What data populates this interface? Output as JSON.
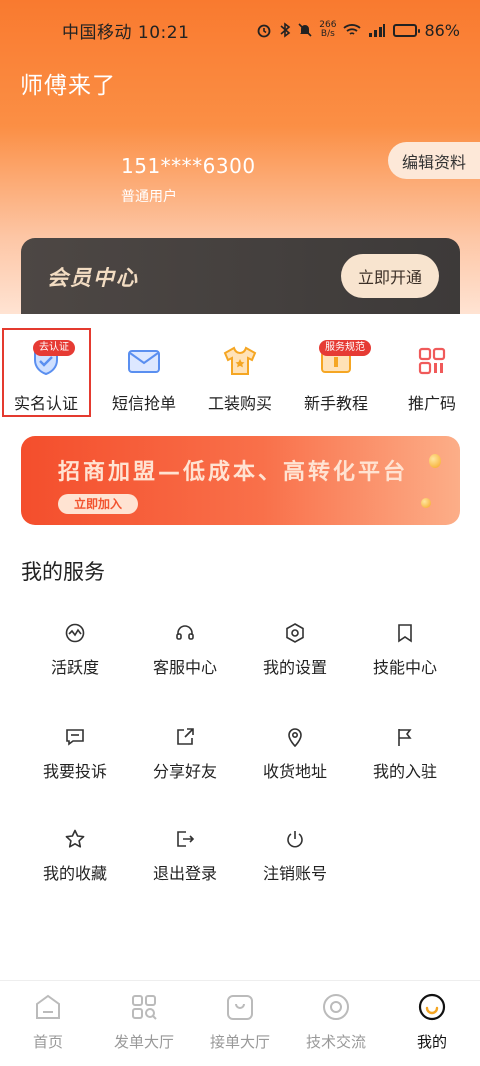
{
  "status_bar": {
    "carrier_time": "中国移动 10:21",
    "net_speed_value": "266",
    "net_speed_unit": "B/s",
    "battery_percent": "86%",
    "battery_level": 0.86
  },
  "header": {
    "app_title": "师傅来了",
    "phone": "151****6300",
    "user_type": "普通用户",
    "edit_label": "编辑资料"
  },
  "vip": {
    "title": "会员中心",
    "button_label": "立即开通"
  },
  "quick_actions": [
    {
      "label": "实名认证",
      "badge": "去认证",
      "icon": "shield-check-icon"
    },
    {
      "label": "短信抢单",
      "icon": "envelope-icon"
    },
    {
      "label": "工装购买",
      "icon": "shirt-icon"
    },
    {
      "label": "新手教程",
      "badge": "服务规范",
      "icon": "monitor-icon"
    },
    {
      "label": "推广码",
      "icon": "qr-code-icon"
    }
  ],
  "banner": {
    "title": "招商加盟—低成本、高转化平台",
    "button_label": "立即加入"
  },
  "services": {
    "title": "我的服务",
    "items": [
      {
        "label": "活跃度",
        "icon": "activity-icon"
      },
      {
        "label": "客服中心",
        "icon": "headset-icon"
      },
      {
        "label": "我的设置",
        "icon": "settings-hex-icon"
      },
      {
        "label": "技能中心",
        "icon": "bookmark-icon"
      },
      {
        "label": "我要投诉",
        "icon": "message-icon"
      },
      {
        "label": "分享好友",
        "icon": "share-icon"
      },
      {
        "label": "收货地址",
        "icon": "location-pin-icon"
      },
      {
        "label": "我的入驻",
        "icon": "flag-icon"
      },
      {
        "label": "我的收藏",
        "icon": "star-icon"
      },
      {
        "label": "退出登录",
        "icon": "logout-icon"
      },
      {
        "label": "注销账号",
        "icon": "power-icon"
      }
    ]
  },
  "tabs": [
    {
      "label": "首页",
      "icon": "home-icon"
    },
    {
      "label": "发单大厅",
      "icon": "grid-search-icon"
    },
    {
      "label": "接单大厅",
      "icon": "order-box-icon"
    },
    {
      "label": "技术交流",
      "icon": "community-icon"
    },
    {
      "label": "我的",
      "icon": "profile-face-icon",
      "active": true
    }
  ],
  "colors": {
    "brand_orange": "#f97a2f",
    "badge_red": "#e63b34",
    "icon_blue": "#5a8ff0",
    "icon_orange": "#f5a623"
  }
}
